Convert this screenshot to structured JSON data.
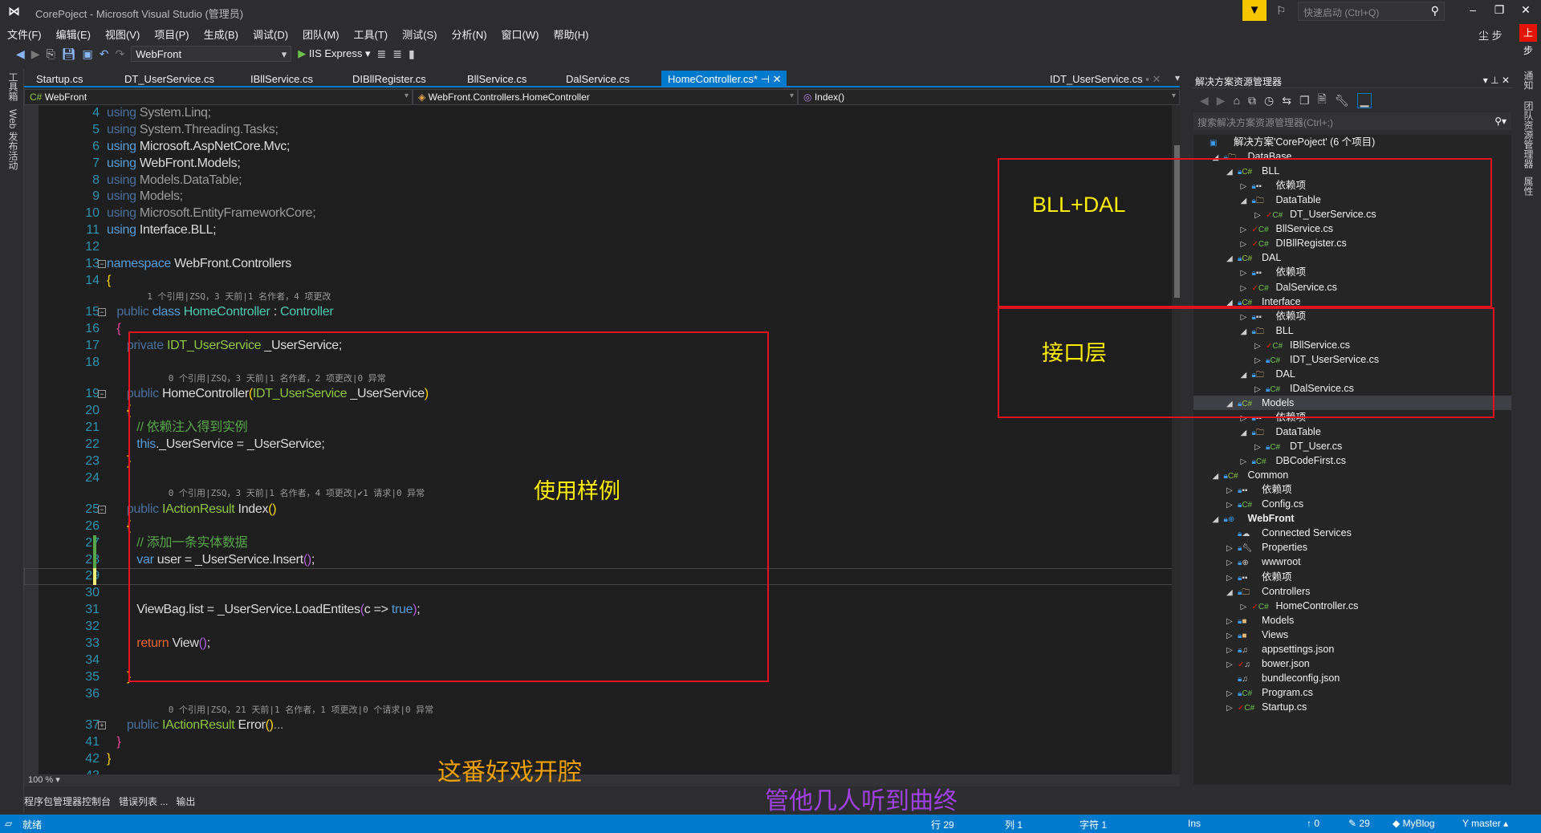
{
  "window": {
    "title": "CorePoject - Microsoft Visual Studio (管理员)",
    "quick_launch_placeholder": "快速启动 (Ctrl+Q)",
    "user": "尘 步",
    "user_badge": "上步"
  },
  "menu": [
    "文件(F)",
    "编辑(E)",
    "视图(V)",
    "项目(P)",
    "生成(B)",
    "调试(D)",
    "团队(M)",
    "工具(T)",
    "测试(S)",
    "分析(N)",
    "窗口(W)",
    "帮助(H)"
  ],
  "toolbar": {
    "startup_project": "WebFront",
    "run_target": "IIS Express"
  },
  "left_strip": [
    "工具箱",
    "Web 发布活动"
  ],
  "right_strip": [
    "通知",
    "团队资源管理器",
    "属性"
  ],
  "tabs": [
    {
      "label": "Startup.cs"
    },
    {
      "label": "DT_UserService.cs"
    },
    {
      "label": "IBllService.cs"
    },
    {
      "label": "DIBllRegister.cs"
    },
    {
      "label": "BllService.cs"
    },
    {
      "label": "DalService.cs"
    },
    {
      "label": "HomeController.cs*",
      "active": true
    }
  ],
  "preview_tab": "IDT_UserService.cs",
  "nav": {
    "project": "WebFront",
    "type": "WebFront.Controllers.HomeController",
    "member": "Index()"
  },
  "code": [
    {
      "n": "4",
      "t": [
        [
          "using ",
          "kd"
        ],
        [
          "System.Linq;",
          "dim"
        ]
      ]
    },
    {
      "n": "5",
      "t": [
        [
          "using ",
          "kd"
        ],
        [
          "System.Threading.Tasks;",
          "dim"
        ]
      ]
    },
    {
      "n": "6",
      "t": [
        [
          "using ",
          "kw"
        ],
        [
          "Microsoft.AspNetCore.Mvc;",
          "pl"
        ]
      ]
    },
    {
      "n": "7",
      "t": [
        [
          "using ",
          "kw"
        ],
        [
          "WebFront.Models;",
          "pl"
        ]
      ]
    },
    {
      "n": "8",
      "t": [
        [
          "using ",
          "kd"
        ],
        [
          "Models.DataTable;",
          "dim"
        ]
      ]
    },
    {
      "n": "9",
      "t": [
        [
          "using ",
          "kd"
        ],
        [
          "Models;",
          "dim"
        ]
      ]
    },
    {
      "n": "10",
      "t": [
        [
          "using ",
          "kd"
        ],
        [
          "Microsoft.EntityFrameworkCore;",
          "dim"
        ]
      ]
    },
    {
      "n": "11",
      "t": [
        [
          "using ",
          "kw"
        ],
        [
          "Interface.BLL;",
          "pl"
        ]
      ]
    },
    {
      "n": "12",
      "t": []
    },
    {
      "n": "13",
      "fold": "-",
      "t": [
        [
          "namespace ",
          "kw"
        ],
        [
          "WebFront.Controllers",
          "pl"
        ]
      ]
    },
    {
      "n": "14",
      "t": [
        [
          "{",
          "yb"
        ]
      ]
    },
    {
      "lens": "  1 个引用|ZSQ，3 天前|1 名作者，4 项更改"
    },
    {
      "n": "15",
      "fold": "-",
      "t": [
        [
          "   public ",
          "kd"
        ],
        [
          "class ",
          "kw"
        ],
        [
          "HomeController",
          "ty"
        ],
        [
          " : ",
          "pl"
        ],
        [
          "Controller",
          "ty"
        ]
      ]
    },
    {
      "n": "16",
      "t": [
        [
          "   {",
          "pk"
        ]
      ]
    },
    {
      "n": "17",
      "t": [
        [
          "      private ",
          "kd"
        ],
        [
          "IDT_UserService",
          "gt"
        ],
        [
          " _UserService;",
          "pl"
        ]
      ]
    },
    {
      "n": "18",
      "t": []
    },
    {
      "lens": "      0 个引用|ZSQ，3 天前|1 名作者，2 项更改|0 异常"
    },
    {
      "n": "19",
      "fold": "-",
      "t": [
        [
          "      public ",
          "kd"
        ],
        [
          "HomeController",
          "pl"
        ],
        [
          "(",
          "yb"
        ],
        [
          "IDT_UserService",
          "gt"
        ],
        [
          " _UserService",
          "pl"
        ],
        [
          ")",
          "yb"
        ]
      ]
    },
    {
      "n": "20",
      "t": [
        [
          "      {",
          "yb"
        ]
      ]
    },
    {
      "n": "21",
      "t": [
        [
          "         // 依赖注入得到实例",
          "cm"
        ]
      ]
    },
    {
      "n": "22",
      "t": [
        [
          "         this",
          "kw"
        ],
        [
          "._UserService = _UserService;",
          "pl"
        ]
      ]
    },
    {
      "n": "23",
      "t": [
        [
          "      }",
          "yb"
        ]
      ]
    },
    {
      "n": "24",
      "t": []
    },
    {
      "lens": "      0 个引用|ZSQ，3 天前|1 名作者，4 项更改|✔1 请求|0 异常"
    },
    {
      "n": "25",
      "fold": "-",
      "t": [
        [
          "      public ",
          "kd"
        ],
        [
          "IActionResult",
          "gt"
        ],
        [
          " Index",
          "pl"
        ],
        [
          "()",
          "yb"
        ]
      ]
    },
    {
      "n": "26",
      "t": [
        [
          "      {",
          "yb"
        ]
      ]
    },
    {
      "n": "27",
      "mod": "saved",
      "t": [
        [
          "         // 添加一条实体数据",
          "cm"
        ]
      ]
    },
    {
      "n": "28",
      "mod": "saved",
      "t": [
        [
          "         var ",
          "kw"
        ],
        [
          "user = _UserService.Insert",
          "pl"
        ],
        [
          "()",
          "pb"
        ],
        [
          ";",
          "pl"
        ]
      ]
    },
    {
      "n": "29",
      "mod": "unsaved",
      "cur": true,
      "t": []
    },
    {
      "n": "30",
      "t": []
    },
    {
      "n": "31",
      "t": [
        [
          "         ViewBag.list = _UserService.LoadEntites",
          "pl"
        ],
        [
          "(",
          "pb"
        ],
        [
          "c => ",
          "pl"
        ],
        [
          "true",
          "kw"
        ],
        [
          ")",
          "pb"
        ],
        [
          ";",
          "pl"
        ]
      ]
    },
    {
      "n": "32",
      "t": []
    },
    {
      "n": "33",
      "t": [
        [
          "         return ",
          "rt"
        ],
        [
          "View",
          "pl"
        ],
        [
          "()",
          "pb"
        ],
        [
          ";",
          "pl"
        ]
      ]
    },
    {
      "n": "34",
      "t": []
    },
    {
      "n": "35",
      "t": [
        [
          "      }",
          "yb"
        ]
      ]
    },
    {
      "n": "36",
      "t": []
    },
    {
      "lens": "      0 个引用|ZSQ，21 天前|1 名作者，1 项更改|0 个请求|0 异常"
    },
    {
      "n": "37",
      "fold": "+",
      "t": [
        [
          "      public ",
          "kd"
        ],
        [
          "IActionResult",
          "gt"
        ],
        [
          " Error",
          "pl"
        ],
        [
          "()",
          "yb"
        ],
        [
          "...",
          "dim"
        ]
      ]
    },
    {
      "n": "41",
      "t": [
        [
          "   }",
          "pk"
        ]
      ]
    },
    {
      "n": "42",
      "t": [
        [
          "}",
          "yb"
        ]
      ]
    },
    {
      "n": "43",
      "t": []
    }
  ],
  "editor": {
    "zoom": "100 %"
  },
  "bottom_tabs": [
    "程序包管理器控制台",
    "错误列表 ...",
    "输出"
  ],
  "status": {
    "ready": "就绪",
    "line": "行 29",
    "col": "列 1",
    "char": "字符 1",
    "mode": "Ins",
    "push": "0",
    "changes": "29",
    "repo": "MyBlog",
    "branch": "master"
  },
  "solution_explorer": {
    "title": "解决方案资源管理器",
    "search_placeholder": "搜索解决方案资源管理器(Ctrl+;)",
    "items": [
      {
        "l": 0,
        "label": "解决方案'CorePoject' (6 个项目)",
        "icon": "solution",
        "a": ""
      },
      {
        "l": 1,
        "label": "DataBase",
        "icon": "folder",
        "a": "open"
      },
      {
        "l": 2,
        "label": "BLL",
        "icon": "csproj",
        "a": "open"
      },
      {
        "l": 3,
        "label": "依赖项",
        "icon": "deps",
        "a": "closed"
      },
      {
        "l": 3,
        "label": "DataTable",
        "icon": "folder",
        "a": "open"
      },
      {
        "l": 4,
        "label": "DT_UserService.cs",
        "icon": "cs-modified",
        "a": "closed"
      },
      {
        "l": 3,
        "label": "BllService.cs",
        "icon": "cs-modified",
        "a": "closed"
      },
      {
        "l": 3,
        "label": "DIBllRegister.cs",
        "icon": "cs-modified",
        "a": "closed"
      },
      {
        "l": 2,
        "label": "DAL",
        "icon": "csproj",
        "a": "open"
      },
      {
        "l": 3,
        "label": "依赖项",
        "icon": "deps",
        "a": "closed"
      },
      {
        "l": 3,
        "label": "DalService.cs",
        "icon": "cs-modified",
        "a": "closed"
      },
      {
        "l": 2,
        "label": "Interface",
        "icon": "csproj",
        "a": "open"
      },
      {
        "l": 3,
        "label": "依赖项",
        "icon": "deps",
        "a": "closed"
      },
      {
        "l": 3,
        "label": "BLL",
        "icon": "folder",
        "a": "open"
      },
      {
        "l": 4,
        "label": "IBllService.cs",
        "icon": "cs-modified",
        "a": "closed"
      },
      {
        "l": 4,
        "label": "IDT_UserService.cs",
        "icon": "cs",
        "a": "closed"
      },
      {
        "l": 3,
        "label": "DAL",
        "icon": "folder",
        "a": "open"
      },
      {
        "l": 4,
        "label": "IDalService.cs",
        "icon": "cs",
        "a": "closed"
      },
      {
        "l": 2,
        "label": "Models",
        "icon": "csproj",
        "a": "open",
        "sel": true
      },
      {
        "l": 3,
        "label": "依赖项",
        "icon": "deps",
        "a": "closed"
      },
      {
        "l": 3,
        "label": "DataTable",
        "icon": "folder",
        "a": "open"
      },
      {
        "l": 4,
        "label": "DT_User.cs",
        "icon": "cs",
        "a": "closed"
      },
      {
        "l": 3,
        "label": "DBCodeFirst.cs",
        "icon": "cs",
        "a": "closed"
      },
      {
        "l": 1,
        "label": "Common",
        "icon": "csproj",
        "a": "open"
      },
      {
        "l": 2,
        "label": "依赖项",
        "icon": "deps",
        "a": "closed"
      },
      {
        "l": 2,
        "label": "Config.cs",
        "icon": "cs",
        "a": "closed"
      },
      {
        "l": 1,
        "label": "WebFront",
        "icon": "webproj",
        "a": "open",
        "bold": true
      },
      {
        "l": 2,
        "label": "Connected Services",
        "icon": "cloud",
        "a": ""
      },
      {
        "l": 2,
        "label": "Properties",
        "icon": "wrench",
        "a": "closed"
      },
      {
        "l": 2,
        "label": "wwwroot",
        "icon": "globe",
        "a": "closed"
      },
      {
        "l": 2,
        "label": "依赖项",
        "icon": "deps",
        "a": "closed"
      },
      {
        "l": 2,
        "label": "Controllers",
        "icon": "folder",
        "a": "open"
      },
      {
        "l": 3,
        "label": "HomeController.cs",
        "icon": "cs-modified",
        "a": "closed"
      },
      {
        "l": 2,
        "label": "Models",
        "icon": "folder-filled",
        "a": "closed"
      },
      {
        "l": 2,
        "label": "Views",
        "icon": "folder-filled",
        "a": "closed"
      },
      {
        "l": 2,
        "label": "appsettings.json",
        "icon": "json",
        "a": "closed"
      },
      {
        "l": 2,
        "label": "bower.json",
        "icon": "json-modified",
        "a": "closed"
      },
      {
        "l": 2,
        "label": "bundleconfig.json",
        "icon": "json",
        "a": ""
      },
      {
        "l": 2,
        "label": "Program.cs",
        "icon": "cs",
        "a": "closed"
      },
      {
        "l": 2,
        "label": "Startup.cs",
        "icon": "cs-modified",
        "a": "closed"
      }
    ]
  },
  "annotations": {
    "bll_dal": "BLL+DAL",
    "interface_layer": "接口层",
    "usage_example": "使用样例",
    "lyric1": "这番好戏开腔",
    "lyric2": "管他几人听到曲终"
  },
  "colors": {
    "accent": "#007acc",
    "annotation_box": "#e0141e",
    "annotation_yellow": "#ffee00",
    "lyric1": "#f0a000",
    "lyric2": "#a040e0"
  }
}
